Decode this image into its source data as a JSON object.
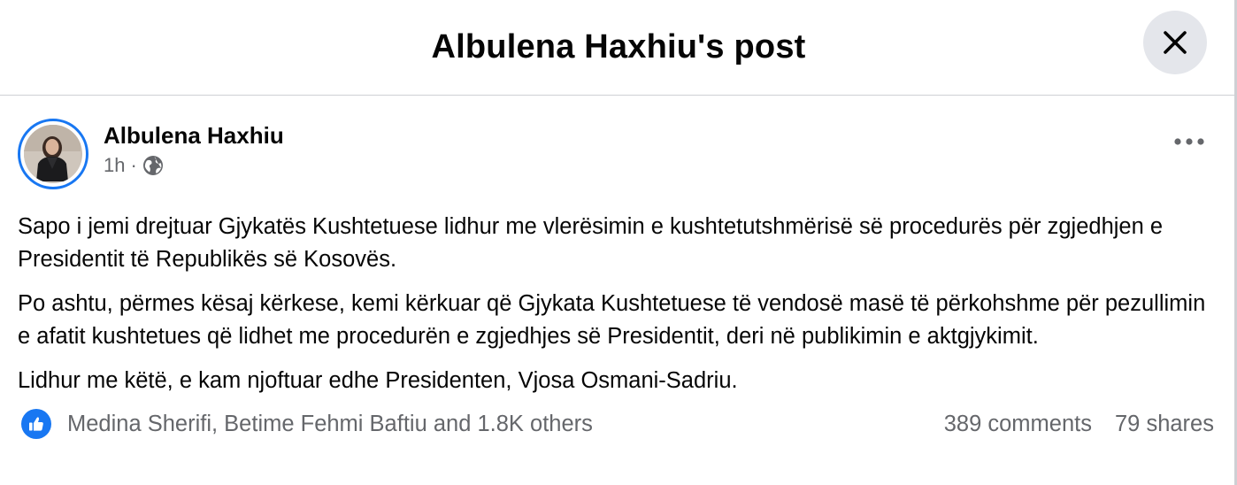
{
  "dialog": {
    "title": "Albulena Haxhiu's post"
  },
  "post": {
    "author": "Albulena Haxhiu",
    "time": "1h",
    "separator": "·",
    "paragraphs": [
      "Sapo i jemi drejtuar Gjykatës Kushtetuese lidhur me vlerësimin e kushtetutshmërisë së procedurës për zgjedhjen e Presidentit të Republikës së Kosovës.",
      "Po ashtu, përmes kësaj kërkese, kemi kërkuar që Gjykata Kushtetuese të vendosë masë të përkohshme për pezullimin e afatit kushtetues që lidhet me procedurën e zgjedhjes së Presidentit, deri në publikimin e aktgjykimit.",
      "Lidhur me këtë, e kam njoftuar edhe Presidenten, Vjosa Osmani-Sadriu."
    ],
    "reactions_text": "Medina Sherifi, Betime Fehmi Baftiu and 1.8K others",
    "comments": "389 comments",
    "shares": "79 shares"
  },
  "icons": {
    "close": "close-icon",
    "globe": "globe-icon",
    "more": "more-horizontal-icon",
    "like": "like-thumb-icon"
  },
  "colors": {
    "accent": "#1877f2",
    "secondary_text": "#65676b",
    "close_bg": "#e4e6eb",
    "divider": "#ced0d4"
  }
}
